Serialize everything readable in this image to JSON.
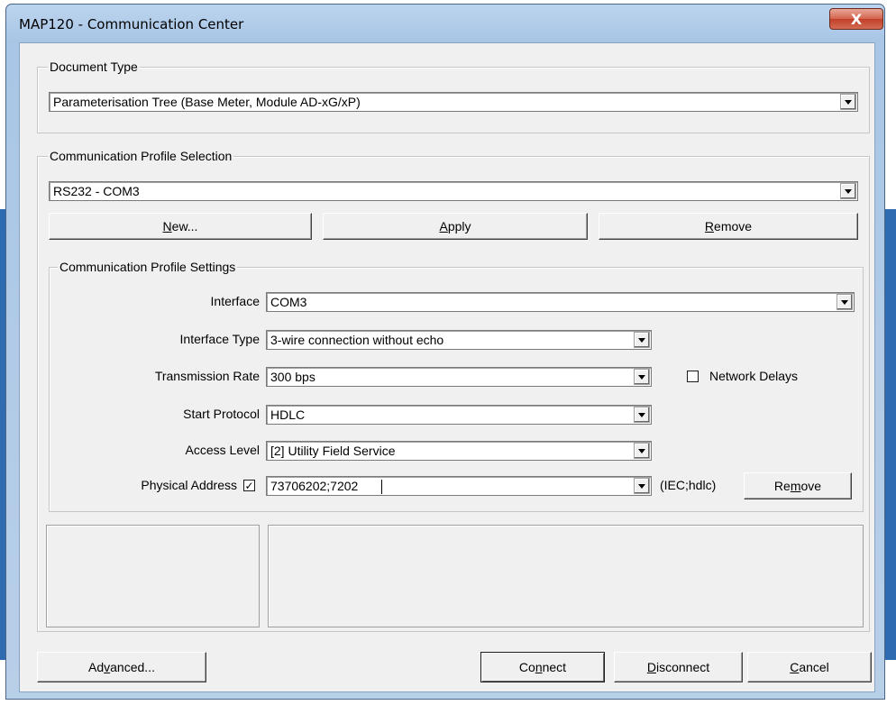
{
  "window": {
    "title": "MAP120 - Communication Center",
    "close_glyph": "X"
  },
  "document_type": {
    "group_title": "Document Type",
    "selected": "Parameterisation Tree (Base Meter, Module AD-xG/xP)"
  },
  "profile_selection": {
    "group_title": "Communication Profile Selection",
    "selected": "RS232 - COM3",
    "buttons": {
      "new": {
        "underline": "N",
        "rest": "ew..."
      },
      "apply": {
        "underline": "A",
        "rest": "pply"
      },
      "remove": {
        "underline": "R",
        "rest": "emove"
      }
    }
  },
  "profile_settings": {
    "group_title": "Communication Profile Settings",
    "interface": {
      "label": "Interface",
      "value": "COM3"
    },
    "interface_type": {
      "label": "Interface Type",
      "value": "3-wire connection without echo"
    },
    "transmission_rate": {
      "label": "Transmission Rate",
      "value": "300 bps"
    },
    "network_delays": {
      "label": "Network Delays",
      "checked": false
    },
    "start_protocol": {
      "label": "Start Protocol",
      "value": "HDLC"
    },
    "access_level": {
      "label": "Access Level",
      "value": "[2] Utility Field Service"
    },
    "physical_address": {
      "label": "Physical Address",
      "checked": true,
      "check_glyph": "✓",
      "value": "73706202;7202",
      "format": "(IEC;hdlc)",
      "remove_button": {
        "before": "Re",
        "underline": "m",
        "after": "ove"
      }
    }
  },
  "footer": {
    "advanced": {
      "before": "Ad",
      "underline": "v",
      "after": "anced..."
    },
    "connect": {
      "before": "Co",
      "underline": "n",
      "after": "nect"
    },
    "disconnect": {
      "before": "",
      "underline": "D",
      "after": "isconnect"
    },
    "cancel": {
      "before": "",
      "underline": "C",
      "after": "ancel"
    }
  },
  "colors": {
    "window_frame": "#a9c6e6",
    "client_background": "#f0f0f0",
    "close_button": "#c1402a"
  }
}
